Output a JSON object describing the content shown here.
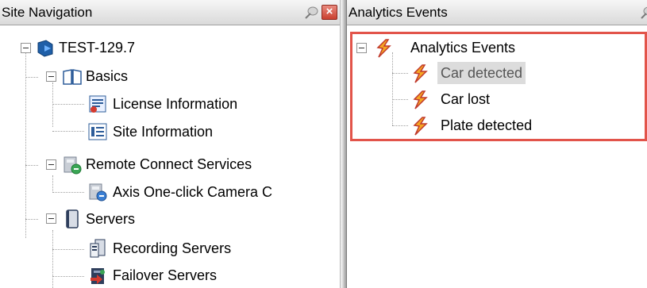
{
  "left_panel": {
    "title": "Site Navigation",
    "tree": {
      "root": "TEST-129.7",
      "basics": "Basics",
      "license_information": "License Information",
      "site_information": "Site Information",
      "remote_connect_services": "Remote Connect Services",
      "axis_one_click": "Axis One-click Camera C",
      "servers": "Servers",
      "recording_servers": "Recording Servers",
      "failover_servers": "Failover Servers"
    }
  },
  "right_panel": {
    "title": "Analytics Events",
    "tree": {
      "root": "Analytics Events",
      "items": [
        "Car detected",
        "Car lost",
        "Plate detected"
      ],
      "selected": "Car detected"
    }
  },
  "colors": {
    "highlight_border": "#e2544a",
    "close_button": "#c9402f",
    "selection": "#dcdcdc"
  }
}
